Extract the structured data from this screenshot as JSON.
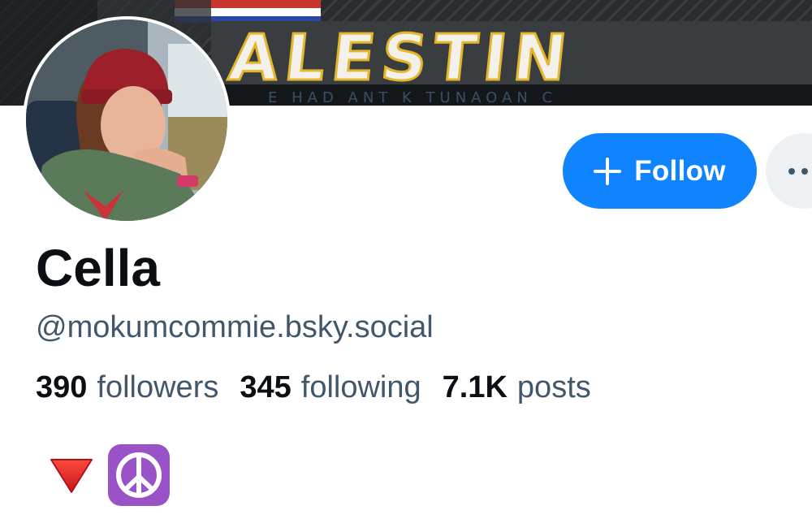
{
  "profile": {
    "display_name": "Cella",
    "handle": "@mokumcommie.bsky.social"
  },
  "stats": {
    "followers_count": "390",
    "followers_label": "followers",
    "following_count": "345",
    "following_label": "following",
    "posts_count": "7.1K",
    "posts_label": "posts"
  },
  "actions": {
    "follow_label": "Follow"
  },
  "banner": {
    "text": "ALESTIN"
  },
  "bio": {
    "emojis": [
      "red-down-triangle",
      "peace-symbol"
    ]
  },
  "colors": {
    "accent": "#1083fe",
    "text_primary": "#0b0f14",
    "text_secondary": "#42576c",
    "more_button_bg": "#eef1f4",
    "peace_bg": "#9a52c9"
  }
}
